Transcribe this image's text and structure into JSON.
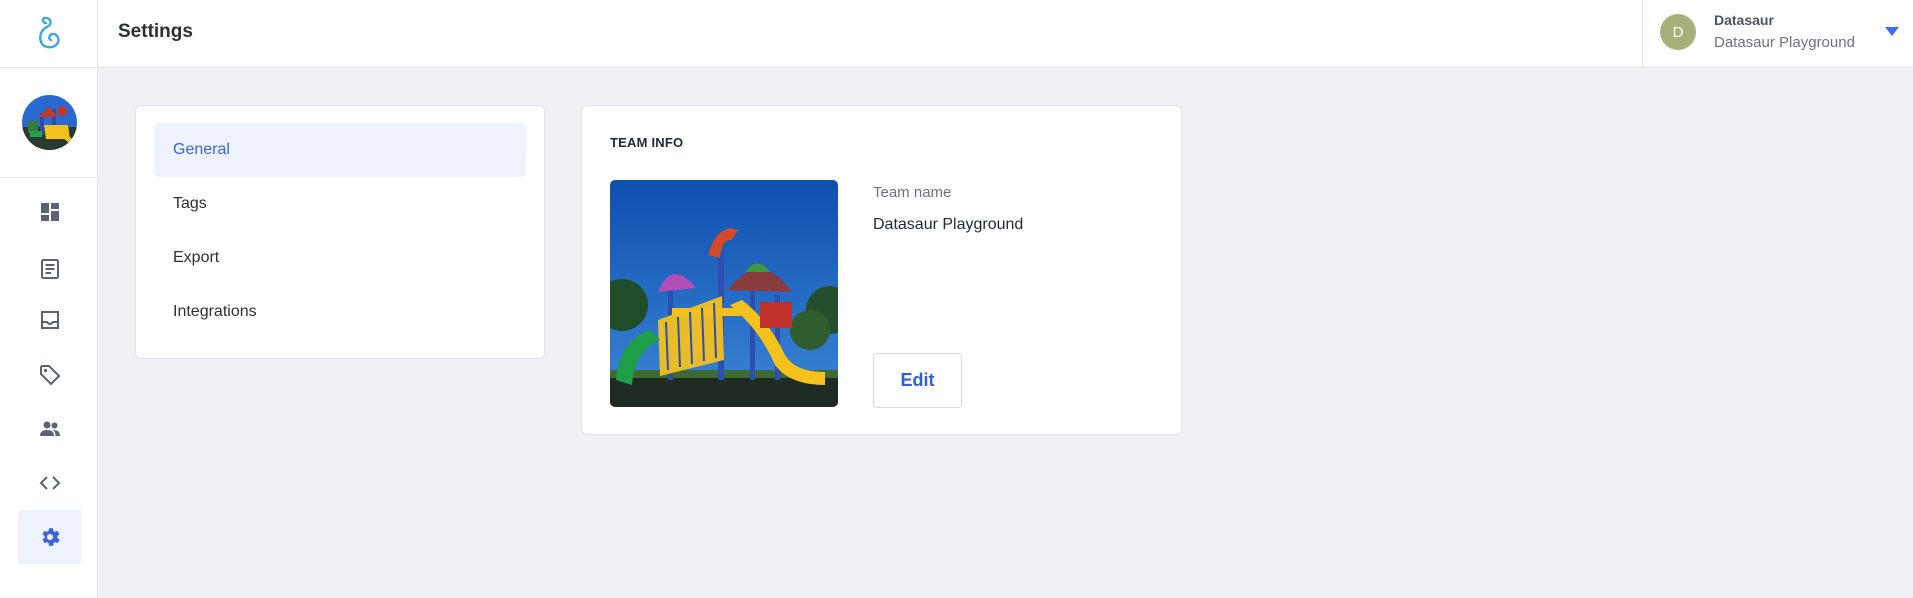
{
  "header": {
    "title": "Settings"
  },
  "account": {
    "initial": "D",
    "name": "Datasaur",
    "team": "Datasaur Playground",
    "avatar_color": "#a7b078"
  },
  "rail": {
    "items": [
      {
        "icon": "dashboard-icon"
      },
      {
        "icon": "document-list-icon"
      },
      {
        "icon": "inbox-icon"
      },
      {
        "icon": "tag-icon"
      },
      {
        "icon": "people-icon"
      },
      {
        "icon": "code-icon"
      },
      {
        "icon": "gear-icon",
        "active": true
      }
    ]
  },
  "settings_menu": {
    "items": [
      {
        "label": "General",
        "active": true
      },
      {
        "label": "Tags"
      },
      {
        "label": "Export"
      },
      {
        "label": "Integrations"
      }
    ]
  },
  "team_info": {
    "heading": "TEAM INFO",
    "team_name_label": "Team name",
    "team_name_value": "Datasaur Playground",
    "edit_label": "Edit"
  },
  "colors": {
    "accent": "#3b64d8",
    "active_bg": "#eef2fd",
    "page_bg": "#f0f1f5"
  }
}
